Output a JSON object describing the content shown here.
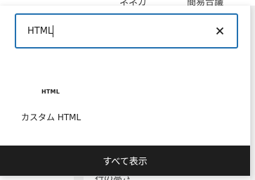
{
  "background": {
    "top_text_1": "ネネガ",
    "top_text_2": "簡易合議",
    "bottom_text": "行の高さ"
  },
  "search": {
    "value": "HTML",
    "clear_icon": "close-icon"
  },
  "results": [
    {
      "icon_text": "HTML",
      "label": "カスタム HTML"
    }
  ],
  "footer": {
    "show_all_label": "すべて表示"
  },
  "colors": {
    "accent": "#2271b1",
    "footer_bg": "#1e1e1e",
    "text": "#1e1e1e"
  }
}
